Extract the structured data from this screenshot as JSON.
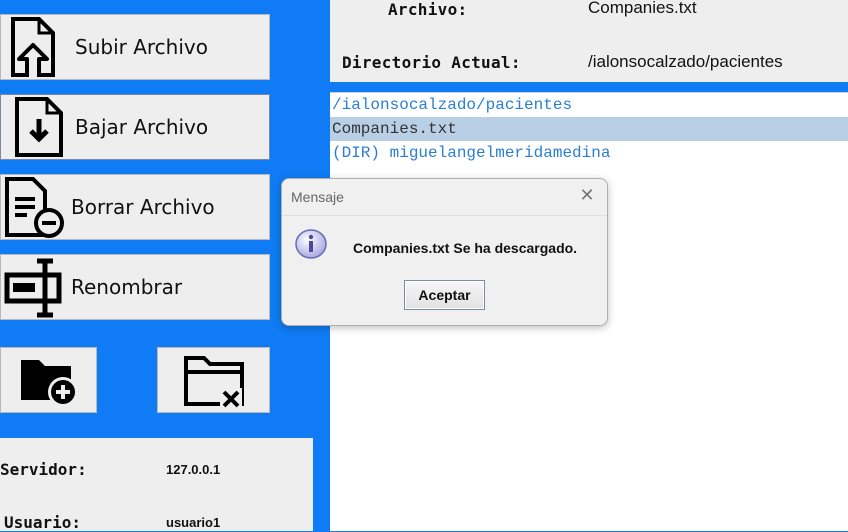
{
  "buttons": {
    "upload": "Subir Archivo",
    "download": "Bajar Archivo",
    "delete": "Borrar Archivo",
    "rename": "Renombrar"
  },
  "info": {
    "server_label": "Servidor:",
    "server_value": "127.0.0.1",
    "user_label": "Usuario:",
    "user_value": "usuario1"
  },
  "header": {
    "file_label": "Archivo:",
    "file_value": "Companies.txt",
    "dir_label": "Directorio Actual:",
    "dir_value": "/ialonsocalzado/pacientes"
  },
  "file_list": [
    "/ialonsocalzado/pacientes",
    "Companies.txt",
    "(DIR) miguelangelmeridamedina"
  ],
  "dialog": {
    "title": "Mensaje",
    "close": "✕",
    "message": "Companies.txt Se ha descargado.",
    "ok": "Aceptar"
  },
  "colors": {
    "background": "#0f7cf5",
    "panel": "#eeeeee",
    "list_text": "#2a7fd4",
    "selection": "#b9cfe6"
  },
  "icons": [
    "upload-file-icon",
    "download-file-icon",
    "delete-file-icon",
    "rename-icon",
    "new-folder-icon",
    "delete-folder-icon",
    "info-icon"
  ]
}
